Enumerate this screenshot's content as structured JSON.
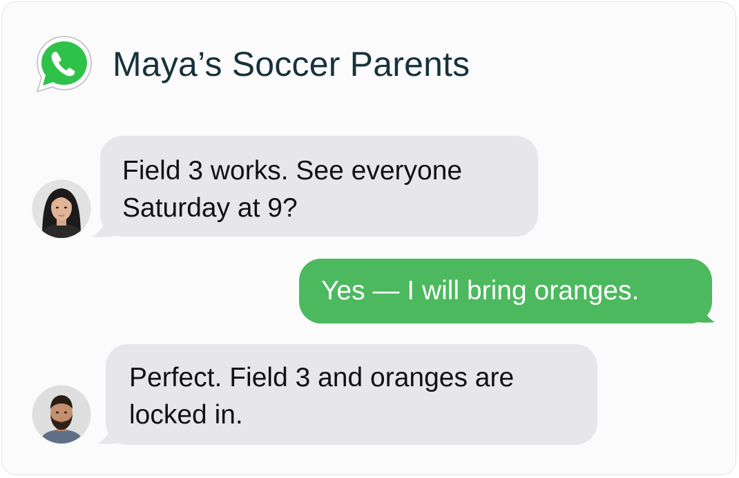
{
  "app": {
    "icon": "whatsapp-icon",
    "brand_color": "#25D366"
  },
  "chat": {
    "title": "Maya’s Soccer Parents"
  },
  "messages": [
    {
      "direction": "incoming",
      "avatar": "woman-avatar",
      "text": "Field 3 works. See everyone\nSaturday at 9?"
    },
    {
      "direction": "outgoing",
      "text": "Yes — I will bring oranges."
    },
    {
      "direction": "incoming",
      "avatar": "man-avatar",
      "text": "Perfect. Field 3 and oranges are\nlocked in."
    }
  ],
  "colors": {
    "incoming_bubble": "#e7e6eb",
    "outgoing_bubble": "#4cb95e",
    "title_text": "#17323a"
  }
}
